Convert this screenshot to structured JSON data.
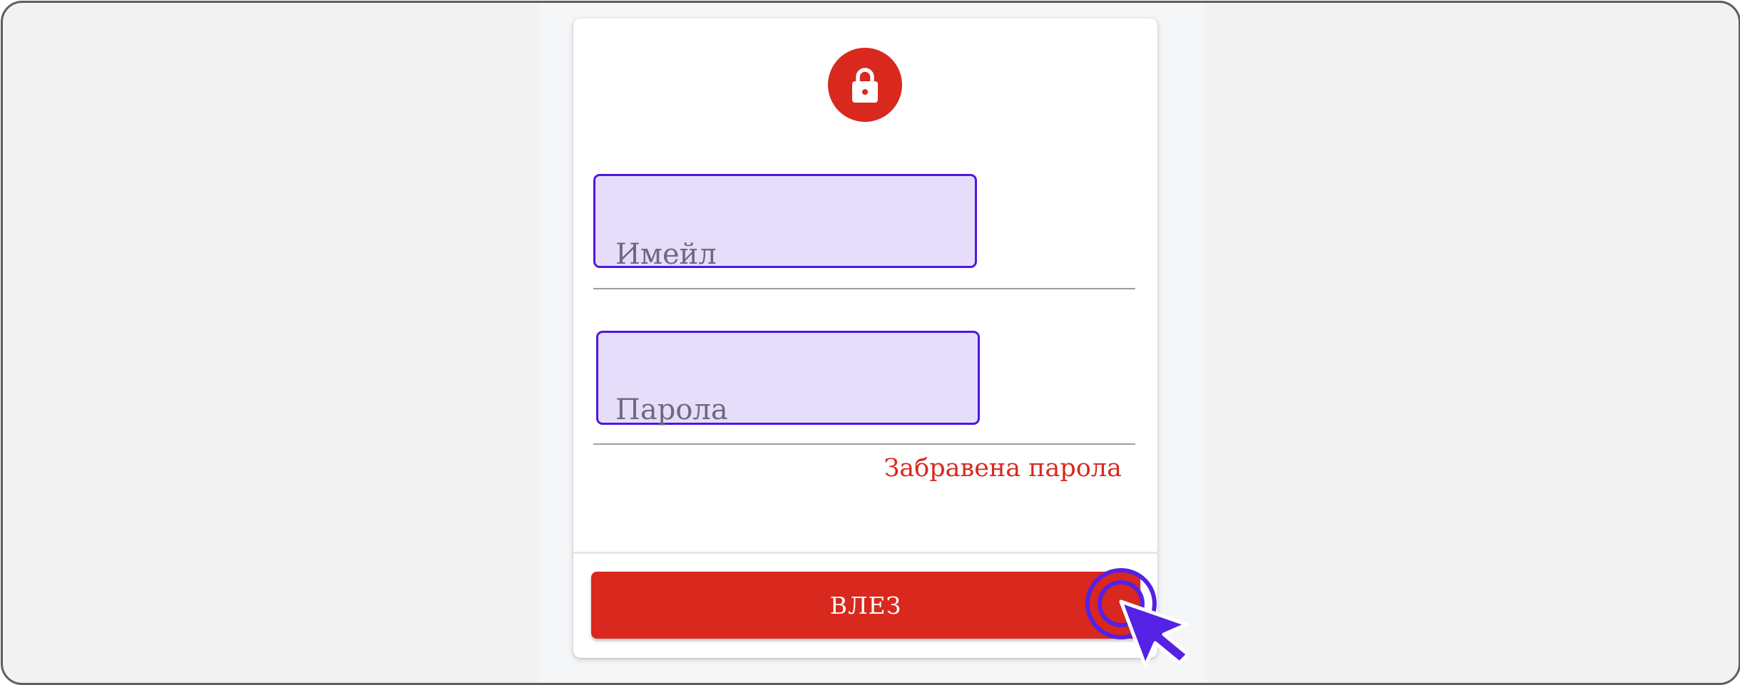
{
  "theme": {
    "accent": "#d9281d",
    "focus_border": "#4f17dc",
    "focus_fill": "#e6ddfa",
    "cursor": "#5521e4"
  },
  "header": {
    "icon": "lock-icon"
  },
  "form": {
    "email": {
      "label": "Имейл",
      "value": ""
    },
    "password": {
      "label": "Парола",
      "value": ""
    },
    "forgot_link": "Забравена парола",
    "submit_label": "ВЛЕЗ"
  },
  "pointer": {
    "icon": "click-cursor-icon"
  }
}
